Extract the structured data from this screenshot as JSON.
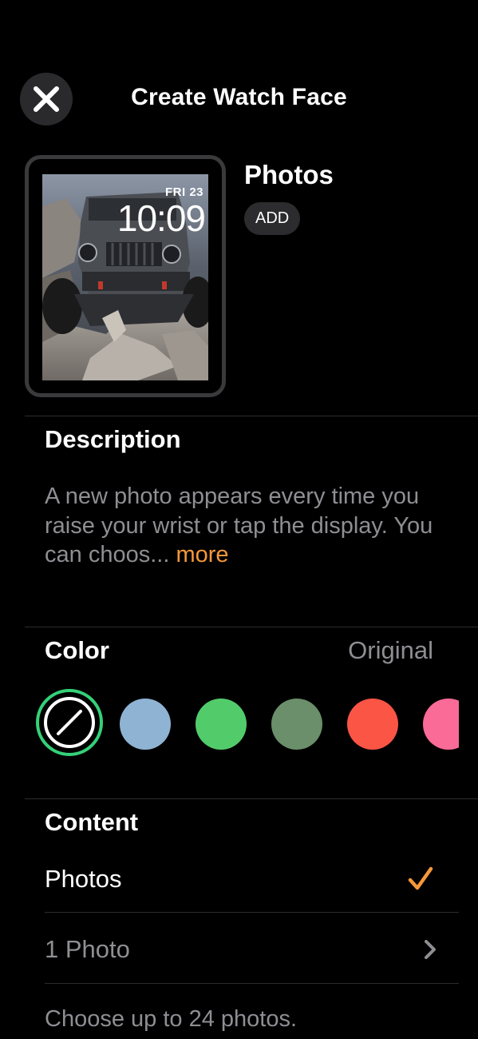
{
  "header": {
    "title": "Create Watch Face",
    "close_icon": "close-icon"
  },
  "watch_preview": {
    "date": "FRI 23",
    "time": "10:09"
  },
  "face": {
    "name": "Photos",
    "add_label": "ADD"
  },
  "description": {
    "title": "Description",
    "text": "A new photo appears every time you raise your wrist or tap the display. You can choos... ",
    "more_label": "more"
  },
  "color": {
    "title": "Color",
    "value": "Original",
    "swatches": [
      {
        "name": "original",
        "hex": "none",
        "selected": true
      },
      {
        "name": "blue",
        "hex": "#8fb3d3"
      },
      {
        "name": "green",
        "hex": "#52cc6a"
      },
      {
        "name": "sage",
        "hex": "#6a8f6a"
      },
      {
        "name": "red",
        "hex": "#fa5545"
      },
      {
        "name": "pink",
        "hex": "#fa6b98"
      }
    ],
    "selected_ring_hex": "#34d178"
  },
  "content": {
    "title": "Content",
    "options": [
      {
        "label": "Photos",
        "checked": true,
        "icon": "checkmark-icon"
      },
      {
        "label": "1 Photo",
        "icon": "chevron-right-icon"
      }
    ],
    "note": "Choose up to 24 photos."
  },
  "accent_hex": "#f5983a"
}
